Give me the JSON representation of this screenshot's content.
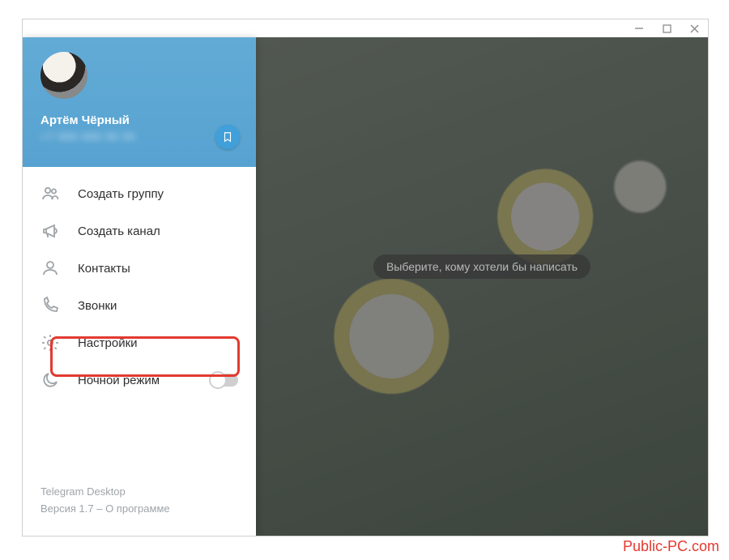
{
  "window": {
    "controls": {
      "min": "—",
      "max": "▢",
      "close": "✕"
    }
  },
  "profile": {
    "name": "Артём Чёрный",
    "phone": "+7 000 000 00 00"
  },
  "menu": {
    "create_group": "Создать группу",
    "create_channel": "Создать канал",
    "contacts": "Контакты",
    "calls": "Звонки",
    "settings": "Настройки",
    "night_mode": "Ночной режим"
  },
  "footer": {
    "app": "Telegram Desktop",
    "version_prefix": "Версия 1.7 – ",
    "about": "О программе"
  },
  "main": {
    "placeholder": "Выберите, кому хотели бы написать"
  },
  "watermark": "Public-PC.com"
}
